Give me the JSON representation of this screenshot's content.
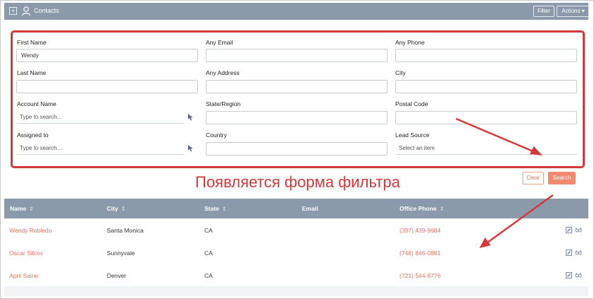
{
  "header": {
    "title": "Contacts",
    "close_glyph": "×",
    "filter_label": "Filter",
    "actions_label": "Actions ▾"
  },
  "filter_form": {
    "first_name": {
      "label": "First Name",
      "value": "Wendy"
    },
    "last_name": {
      "label": "Last Name",
      "value": ""
    },
    "account_name": {
      "label": "Account Name",
      "placeholder": "Type to search..."
    },
    "assigned_to": {
      "label": "Assigned to",
      "placeholder": "Type to search..."
    },
    "any_email": {
      "label": "Any Email",
      "value": ""
    },
    "any_address": {
      "label": "Any Address",
      "value": ""
    },
    "state_region": {
      "label": "State/Region",
      "value": ""
    },
    "country": {
      "label": "Country",
      "value": ""
    },
    "any_phone": {
      "label": "Any Phone",
      "value": ""
    },
    "city": {
      "label": "City",
      "value": ""
    },
    "postal_code": {
      "label": "Postal Code",
      "value": ""
    },
    "lead_source": {
      "label": "Lead Source",
      "placeholder": "Select an item"
    },
    "clear_label": "Clear",
    "search_label": "Search"
  },
  "annotation": {
    "text": "Появляется форма фильтра",
    "color": "#d2393a"
  },
  "table": {
    "columns": [
      "Name",
      "City",
      "State",
      "Email",
      "Office Phone"
    ],
    "rows": [
      {
        "name": "Wendy Robledo",
        "city": "Santa Monica",
        "state": "CA",
        "email": "",
        "phone": "(397) 439-9684"
      },
      {
        "name": "Oscar Silcox",
        "city": "Sunnyvale",
        "state": "CA",
        "email": "",
        "phone": "(746) 846-0881"
      },
      {
        "name": "April Saine",
        "city": "Denver",
        "state": "CA",
        "email": "",
        "phone": "(721) 544-8776"
      }
    ]
  },
  "colors": {
    "header_bg": "#8a9aaa",
    "accent": "#e8725e",
    "highlight": "#d2393a"
  },
  "icons": [
    "close-icon",
    "person-icon",
    "cursor-icon",
    "sort-icon",
    "edit-icon",
    "view-icon"
  ]
}
